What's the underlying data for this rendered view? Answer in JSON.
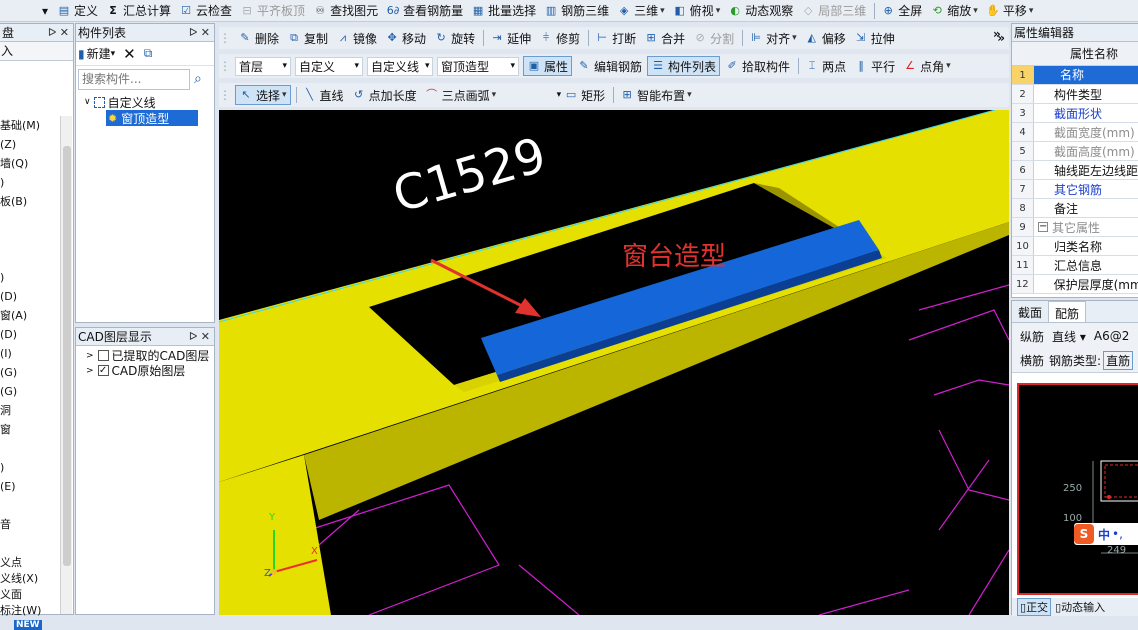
{
  "toolbar1": {
    "items": [
      {
        "label": "定义",
        "icon": "define-icon"
      },
      {
        "label": "汇总计算",
        "icon": "sigma-icon"
      },
      {
        "label": "云检查",
        "icon": "cloud-check-icon"
      },
      {
        "label": "平齐板顶",
        "icon": "align-top-icon",
        "disabled": true
      },
      {
        "label": "查找图元",
        "icon": "binoculars-icon"
      },
      {
        "label": "查看钢筋量",
        "icon": "rebar-view-icon"
      },
      {
        "label": "批量选择",
        "icon": "batch-select-icon"
      },
      {
        "label": "钢筋三维",
        "icon": "rebar-3d-icon"
      },
      {
        "label": "三维",
        "icon": "cube-3d-icon"
      },
      {
        "label": "俯视",
        "icon": "top-view-icon"
      },
      {
        "label": "动态观察",
        "icon": "orbit-icon"
      },
      {
        "label": "局部三维",
        "icon": "local-3d-icon",
        "disabled": true
      },
      {
        "label": "全屏",
        "icon": "fullscreen-icon"
      },
      {
        "label": "缩放",
        "icon": "zoom-icon"
      },
      {
        "label": "平移",
        "icon": "pan-icon"
      }
    ]
  },
  "toolbar2": {
    "items": [
      {
        "label": "删除",
        "icon": "delete-icon"
      },
      {
        "label": "复制",
        "icon": "copy-icon"
      },
      {
        "label": "镜像",
        "icon": "mirror-icon"
      },
      {
        "label": "移动",
        "icon": "move-icon"
      },
      {
        "label": "旋转",
        "icon": "rotate-icon"
      },
      {
        "label": "延伸",
        "icon": "extend-icon"
      },
      {
        "label": "修剪",
        "icon": "trim-icon"
      },
      {
        "label": "打断",
        "icon": "break-icon"
      },
      {
        "label": "合并",
        "icon": "merge-icon"
      },
      {
        "label": "分割",
        "icon": "split-icon",
        "disabled": true
      },
      {
        "label": "对齐",
        "icon": "align-icon"
      },
      {
        "label": "偏移",
        "icon": "offset-icon"
      },
      {
        "label": "拉伸",
        "icon": "stretch-icon"
      }
    ]
  },
  "toolbar3": {
    "floor": "首层",
    "type": "自定义",
    "subtype": "自定义线",
    "component": "窗顶造型",
    "attr_label": "属性",
    "edit_rebar_label": "编辑钢筋",
    "component_list_label": "构件列表",
    "pick_label": "拾取构件",
    "two_point_label": "两点",
    "parallel_label": "平行",
    "point_angle_label": "点角"
  },
  "toolbar4": {
    "select_label": "选择",
    "line_label": "直线",
    "point_length_label": "点加长度",
    "three_arc_label": "三点画弧",
    "rect_label": "矩形",
    "smart_layout_label": "智能布置"
  },
  "left_panel": {
    "title_fragment": "盘",
    "input_fragment": "入",
    "items": [
      "基础(M)",
      "(Z)",
      "墙(Q)",
      ")",
      "板(B)",
      "",
      "",
      "",
      ")",
      "(D)",
      "窗(A)",
      "(D)",
      "(I)",
      "(G)",
      "(G)",
      "洞",
      "窗",
      "",
      ")",
      "(E)",
      "",
      "音",
      "",
      "义点",
      "义线(X)",
      "义面",
      "标注(W)"
    ],
    "new_badge": "NEW"
  },
  "component_list": {
    "title": "构件列表",
    "new_label": "新建",
    "search_placeholder": "搜索构件...",
    "tree_root": "自定义线",
    "tree_child": "窗顶造型"
  },
  "cad_layers": {
    "title": "CAD图层显示",
    "items": [
      {
        "label": "已提取的CAD图层",
        "checked": false
      },
      {
        "label": "CAD原始图层",
        "checked": true
      }
    ]
  },
  "viewport": {
    "window_label": "C1529",
    "annotation": "窗台造型"
  },
  "property_editor": {
    "title": "属性编辑器",
    "header": "属性名称",
    "rows": [
      {
        "num": "1",
        "name": "名称",
        "style": "selected"
      },
      {
        "num": "2",
        "name": "构件类型",
        "style": "normal"
      },
      {
        "num": "3",
        "name": "截面形状",
        "style": "blue"
      },
      {
        "num": "4",
        "name": "截面宽度(mm)",
        "style": "gray"
      },
      {
        "num": "5",
        "name": "截面高度(mm)",
        "style": "gray"
      },
      {
        "num": "6",
        "name": "轴线距左边线距",
        "style": "normal"
      },
      {
        "num": "7",
        "name": "其它钢筋",
        "style": "blue"
      },
      {
        "num": "8",
        "name": "备注",
        "style": "normal"
      },
      {
        "num": "9",
        "name": "其它属性",
        "style": "gray"
      },
      {
        "num": "10",
        "name": "归类名称",
        "style": "normal"
      },
      {
        "num": "11",
        "name": "汇总信息",
        "style": "normal"
      },
      {
        "num": "12",
        "name": "保护层厚度(mm",
        "style": "normal"
      }
    ]
  },
  "section_panel": {
    "tab1": "截面",
    "tab2": "配筋",
    "long_bar_label": "纵筋",
    "line_type": "直线",
    "rebar_value": "A6@2",
    "horizontal_label": "横筋",
    "rebar_type_label": "钢筋类型:",
    "straight_label": "直筋",
    "dim1": "250",
    "dim2": "100",
    "dim3": "249",
    "ime_label": "中",
    "bottom_tab1": "正交",
    "bottom_tab2": "动态输入"
  },
  "colors": {
    "yellow_slab": "#e5e000",
    "blue_beam": "#1566d8",
    "magenta_cad": "#d020d0",
    "red_annotation": "#e0322e"
  }
}
